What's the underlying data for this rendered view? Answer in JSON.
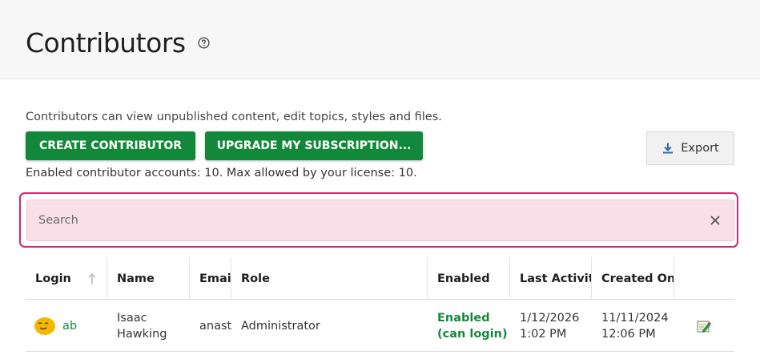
{
  "header": {
    "title": "Contributors"
  },
  "intro": {
    "description": "Contributors can view unpublished content, edit topics, styles and files.",
    "license_text": "Enabled contributor accounts: 10. Max allowed by your license: 10."
  },
  "toolbar": {
    "create_label": "CREATE CONTRIBUTOR",
    "upgrade_label": "UPGRADE MY SUBSCRIPTION...",
    "export_label": "Export"
  },
  "search": {
    "placeholder": "Search",
    "value": ""
  },
  "table": {
    "columns": {
      "login": "Login",
      "name": "Name",
      "email": "Email",
      "role": "Role",
      "enabled": "Enabled",
      "last_activity": "Last Activity",
      "created_on": "Created On"
    },
    "rows": [
      {
        "login": "ab",
        "name_first": "Isaac",
        "name_last": "Hawking",
        "email": "anast",
        "role": "Administrator",
        "enabled_line1": "Enabled",
        "enabled_line2": "(can login)",
        "last_activity_date": "1/12/2026",
        "last_activity_time": "1:02 PM",
        "created_date": "11/11/2024",
        "created_time": "12:06 PM"
      }
    ]
  },
  "colors": {
    "primary": "#12893a",
    "search_highlight": "#d6246e",
    "search_bg": "#f9dfe8"
  }
}
